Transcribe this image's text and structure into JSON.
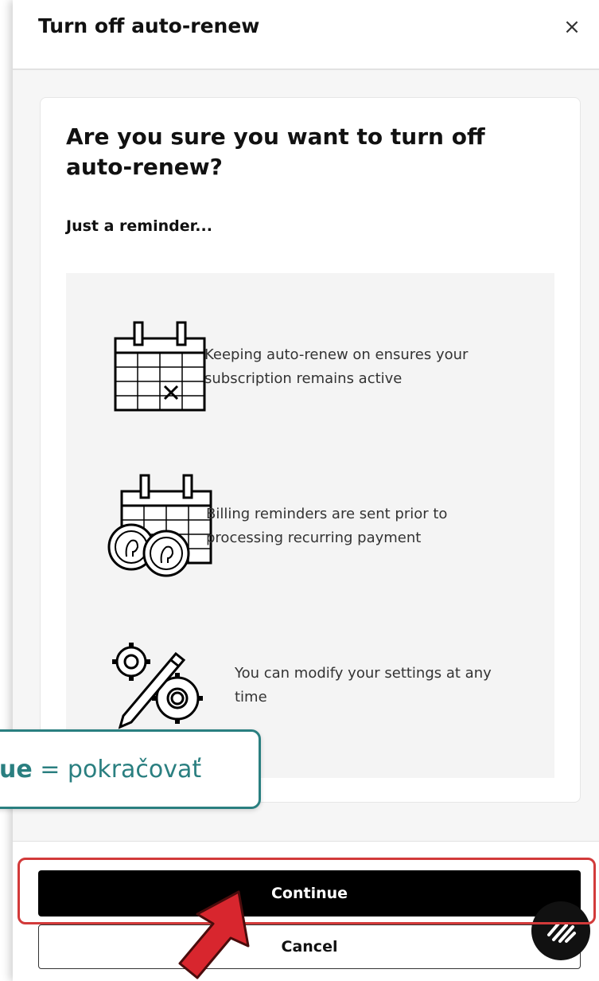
{
  "dialog": {
    "title": "Turn off auto-renew",
    "close_label": "×"
  },
  "content": {
    "heading": "Are you sure you want to turn off auto-renew?",
    "subheading": "Just a reminder...",
    "reminders": [
      {
        "icon": "calendar-icon",
        "text_line1": "Keeping auto-renew on ensures your",
        "text_line2": "subscription remains active"
      },
      {
        "icon": "calendar-coins-icon",
        "text_line1": "Billing reminders are sent prior to",
        "text_line2": "processing recurring payment"
      },
      {
        "icon": "gears-pencil-icon",
        "text_line1": "You can modify your settings at any",
        "text_line2": "time"
      }
    ]
  },
  "footer": {
    "continue_label": "Continue",
    "cancel_label": "Cancel"
  },
  "annotation": {
    "bold_part": "ue",
    "rest": " = pokračovať"
  },
  "colors": {
    "accent_teal": "#2a7f80",
    "highlight_red": "#d23a3a",
    "arrow_red": "#d8262e",
    "button_black": "#000000"
  }
}
